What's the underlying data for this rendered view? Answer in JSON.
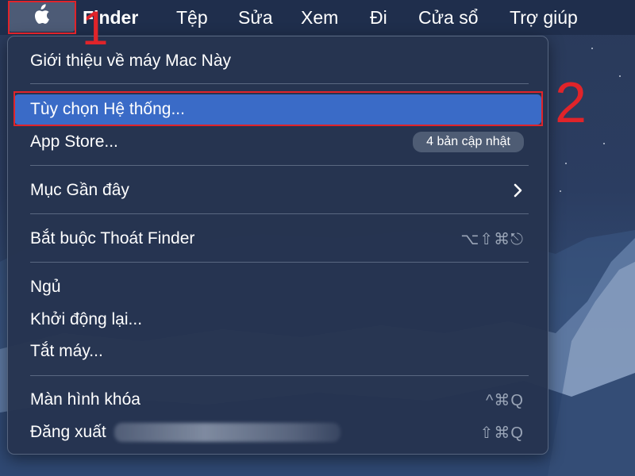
{
  "menubar": {
    "apple_icon": "apple-logo-icon",
    "items": [
      "Finder",
      "Tệp",
      "Sửa",
      "Xem",
      "Đi",
      "Cửa sổ",
      "Trợ giúp"
    ]
  },
  "annotations": {
    "step1": "1",
    "step2": "2",
    "color": "#e0242a"
  },
  "apple_menu": {
    "about": "Giới thiệu về máy Mac Này",
    "system_preferences": "Tùy chọn Hệ thống...",
    "app_store": "App Store...",
    "app_store_badge": "4 bản cập nhật",
    "recent_items": "Mục Gần đây",
    "recent_items_icon": "chevron-right-icon",
    "force_quit": "Bắt buộc Thoát Finder",
    "force_quit_shortcut": "⌥⇧⌘⎋",
    "sleep": "Ngủ",
    "restart": "Khởi động lại...",
    "shutdown": "Tắt máy...",
    "lock_screen": "Màn hình khóa",
    "lock_screen_shortcut": "^⌘Q",
    "logout": "Đăng xuất",
    "logout_shortcut": "⇧⌘Q"
  },
  "colors": {
    "menubar_bg": "#1f2e4c",
    "menu_bg": "#263450",
    "highlight": "#3a6bc7",
    "shortcut_text": "#9aa5b7"
  }
}
